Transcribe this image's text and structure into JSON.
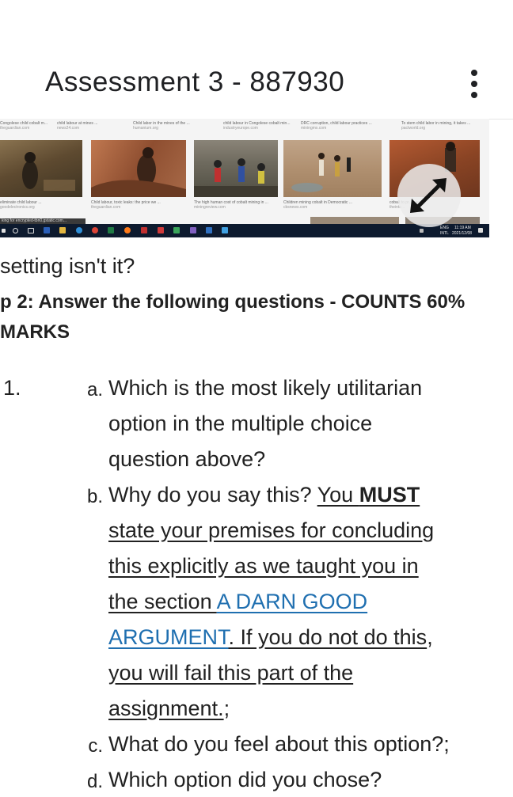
{
  "header": {
    "title": "Assessment 3 - 887930"
  },
  "screenshot": {
    "captions_row1": [
      {
        "title": "Congolese child cobalt m...",
        "source": "theguardian.com"
      },
      {
        "title": "child labour at mines ...",
        "source": "news24.com"
      },
      {
        "title": "Child labor in the mines of the ...",
        "source": "humanium.org"
      },
      {
        "title": "child labour in Congolese cobalt min...",
        "source": "industryeurope.com"
      },
      {
        "title": "DRC corruption, child labour practices ...",
        "source": "miningmx.com"
      },
      {
        "title": "To stem child labor in mining, it takes ...",
        "source": "pactworld.org"
      }
    ],
    "captions_row2": [
      {
        "title": "eliminate child labour ...",
        "source": "goodelectronics.org"
      },
      {
        "title": "Child labour, toxic leaks: the price we ...",
        "source": "theguardian.com"
      },
      {
        "title": "The high human cost of cobalt mining in ...",
        "source": "miningreview.com"
      },
      {
        "title": "Children mining cobalt in Democratic ...",
        "source": "cbsnews.com"
      },
      {
        "title": "cobalt to pr... care...",
        "source": "theinte..."
      }
    ],
    "search_hint": "king for encrypted-tbn0.gstatic.com...",
    "tray_lang": "ENG",
    "tray_region": "INTL",
    "tray_time": "11:19 AM",
    "tray_date": "2021/12/08"
  },
  "content": {
    "intro": "setting isn't it?",
    "step_heading_line1": "p 2: Answer the following questions - COUNTS 60%",
    "step_heading_line2": "MARKS",
    "number": "1.",
    "items": {
      "a_letter": "a.",
      "a_line1": "Which is the most likely utilitarian",
      "a_line2": "option in the multiple choice",
      "a_line3": "question above?",
      "b_letter": "b.",
      "b_line1_plain": "Why do you say this? ",
      "b_line1_u": "You ",
      "b_line1_bold": "MUST",
      "b_line2": "state your premises for concluding",
      "b_line3": "this explicitly as we taught you in",
      "b_line4_u": "the section ",
      "b_line4_link": "A DARN GOOD",
      "b_line5_link": "ARGUMENT",
      "b_line5_u": ". If you do not do this",
      "b_line5_plain": ",",
      "b_line6": "you will fail this part of the",
      "b_line7_u": "assignment.",
      "b_line7_plain": ";",
      "c_letter": "c.",
      "c_line1": "What do you feel about this option?;",
      "d_letter": "d.",
      "d_line1": "Which option did you chose?"
    }
  }
}
